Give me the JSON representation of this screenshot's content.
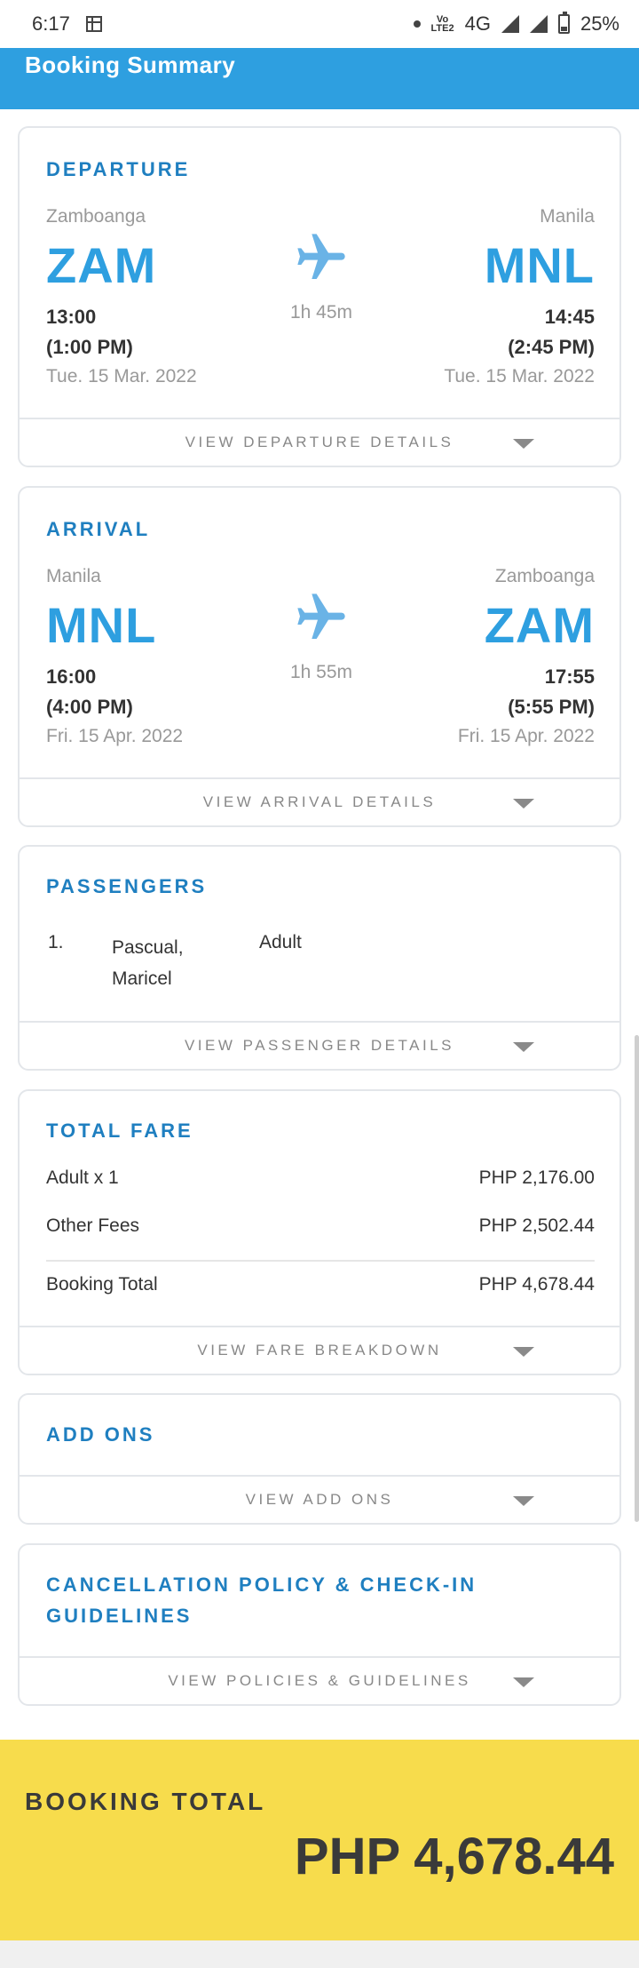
{
  "status_bar": {
    "time": "6:17",
    "network": "4G",
    "volte": "Vo\nLTE2",
    "battery": "25%"
  },
  "header": {
    "title": "Booking Summary"
  },
  "departure": {
    "title": "DEPARTURE",
    "from_city": "Zamboanga",
    "from_code": "ZAM",
    "from_time_24": "13:00",
    "from_time_12": "(1:00 PM)",
    "from_date": "Tue. 15 Mar. 2022",
    "to_city": "Manila",
    "to_code": "MNL",
    "to_time_24": "14:45",
    "to_time_12": "(2:45 PM)",
    "to_date": "Tue. 15 Mar. 2022",
    "duration": "1h 45m",
    "view_label": "VIEW DEPARTURE DETAILS"
  },
  "arrival": {
    "title": "ARRIVAL",
    "from_city": "Manila",
    "from_code": "MNL",
    "from_time_24": "16:00",
    "from_time_12": "(4:00 PM)",
    "from_date": "Fri. 15 Apr. 2022",
    "to_city": "Zamboanga",
    "to_code": "ZAM",
    "to_time_24": "17:55",
    "to_time_12": "(5:55 PM)",
    "to_date": "Fri. 15 Apr. 2022",
    "duration": "1h 55m",
    "view_label": "VIEW ARRIVAL DETAILS"
  },
  "passengers": {
    "title": "PASSENGERS",
    "list": [
      {
        "number": "1.",
        "last_name": "Pascual,",
        "first_name": "Maricel",
        "type": "Adult"
      }
    ],
    "view_label": "VIEW PASSENGER DETAILS"
  },
  "fare": {
    "title": "TOTAL FARE",
    "rows": [
      {
        "label": "Adult x 1",
        "amount": "PHP 2,176.00"
      },
      {
        "label": "Other Fees",
        "amount": "PHP 2,502.44"
      }
    ],
    "total_label": "Booking Total",
    "total_amount": "PHP 4,678.44",
    "view_label": "VIEW FARE BREAKDOWN"
  },
  "addons": {
    "title": "ADD ONS",
    "view_label": "VIEW ADD ONS"
  },
  "policies": {
    "title_line1": "CANCELLATION POLICY & CHECK-IN",
    "title_line2": "GUIDELINES",
    "view_label": "VIEW POLICIES & GUIDELINES"
  },
  "booking_total": {
    "label": "BOOKING TOTAL",
    "amount": "PHP 4,678.44"
  },
  "colors": {
    "accent": "#2e9fe0",
    "title_blue": "#1f7fc0",
    "total_bar": "#f7dc4c"
  }
}
